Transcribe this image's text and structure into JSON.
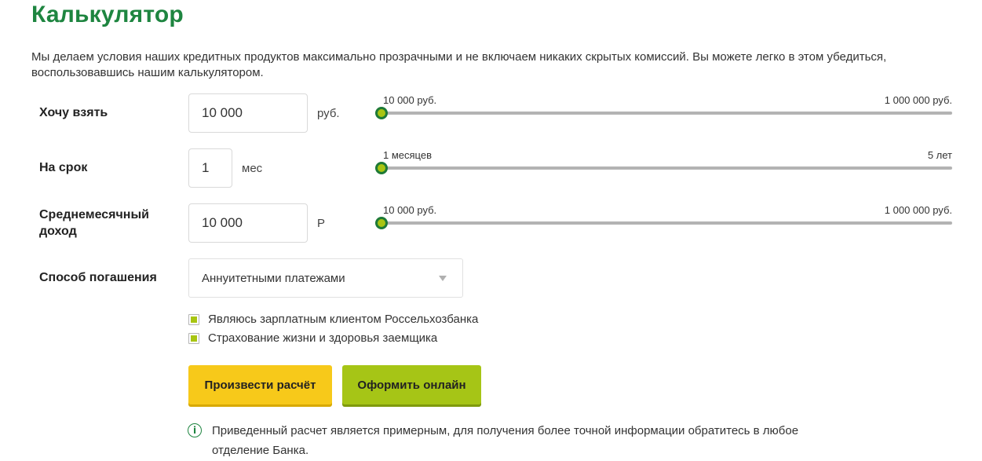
{
  "page": {
    "title": "Калькулятор",
    "intro": "Мы делаем условия наших кредитных продуктов максимально прозрачными и не включаем никаких скрытых комиссий. Вы можете легко в этом убедиться, воспользовавшись нашим калькулятором."
  },
  "amount": {
    "label": "Хочу взять",
    "value": "10 000",
    "unit": "руб.",
    "slider_min": "10 000 руб.",
    "slider_max": "1 000 000 руб.",
    "slider_fraction": 0
  },
  "term": {
    "label": "На срок",
    "value": "1",
    "unit": "мес",
    "slider_min": "1 месяцев",
    "slider_max": "5 лет",
    "slider_fraction": 0
  },
  "income": {
    "label": "Среднемесячный доход",
    "value": "10 000",
    "unit": "Р",
    "slider_min": "10 000 руб.",
    "slider_max": "1 000 000 руб.",
    "slider_fraction": 0
  },
  "repayment": {
    "label": "Способ погашения",
    "selected": "Аннуитетными платежами"
  },
  "checkboxes": [
    {
      "label": "Являюсь зарплатным клиентом Россельхозбанка",
      "checked": true
    },
    {
      "label": "Страхование жизни и здоровья заемщика",
      "checked": true
    }
  ],
  "buttons": {
    "calculate": "Произвести расчёт",
    "apply_online": "Оформить онлайн"
  },
  "note": {
    "icon": "info-icon",
    "text": "Приведенный расчет является примерным, для получения более точной информации обратитесь в любое отделение Банка."
  },
  "colors": {
    "brand_green": "#1e8540",
    "slider_thumb": "#a8c512",
    "button_yellow": "#f7c91a",
    "button_lime": "#a6c516"
  }
}
